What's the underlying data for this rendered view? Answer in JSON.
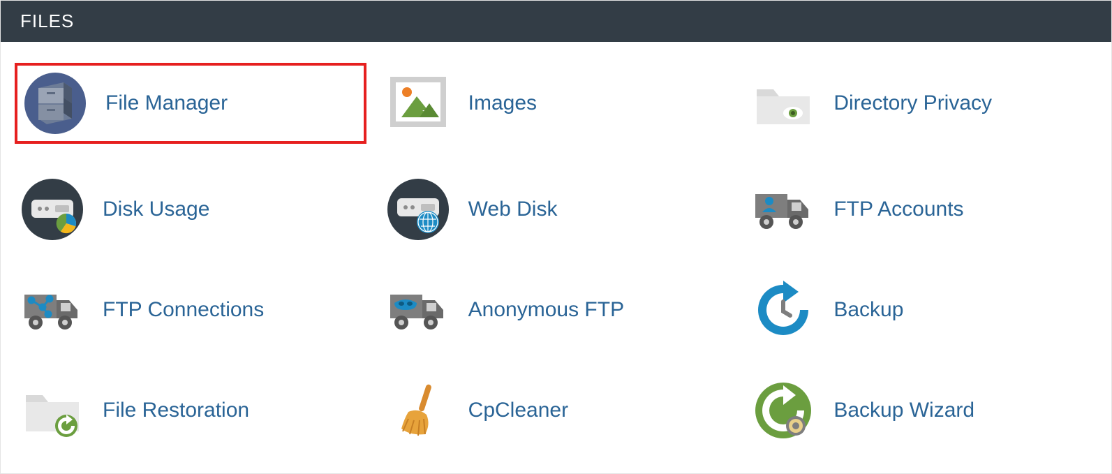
{
  "panel": {
    "title": "FILES",
    "items": [
      {
        "label": "File Manager",
        "icon": "file-manager-icon",
        "highlight": true
      },
      {
        "label": "Images",
        "icon": "images-icon",
        "highlight": false
      },
      {
        "label": "Directory Privacy",
        "icon": "directory-privacy-icon",
        "highlight": false
      },
      {
        "label": "Disk Usage",
        "icon": "disk-usage-icon",
        "highlight": false
      },
      {
        "label": "Web Disk",
        "icon": "web-disk-icon",
        "highlight": false
      },
      {
        "label": "FTP Accounts",
        "icon": "ftp-accounts-icon",
        "highlight": false
      },
      {
        "label": "FTP Connections",
        "icon": "ftp-connections-icon",
        "highlight": false
      },
      {
        "label": "Anonymous FTP",
        "icon": "anonymous-ftp-icon",
        "highlight": false
      },
      {
        "label": "Backup",
        "icon": "backup-icon",
        "highlight": false
      },
      {
        "label": "File Restoration",
        "icon": "file-restoration-icon",
        "highlight": false
      },
      {
        "label": "CpCleaner",
        "icon": "cpcleaner-icon",
        "highlight": false
      },
      {
        "label": "Backup Wizard",
        "icon": "backup-wizard-icon",
        "highlight": false
      }
    ]
  },
  "colors": {
    "link": "#2a6496",
    "headerBg": "#333d46",
    "highlight": "#e6201f"
  }
}
